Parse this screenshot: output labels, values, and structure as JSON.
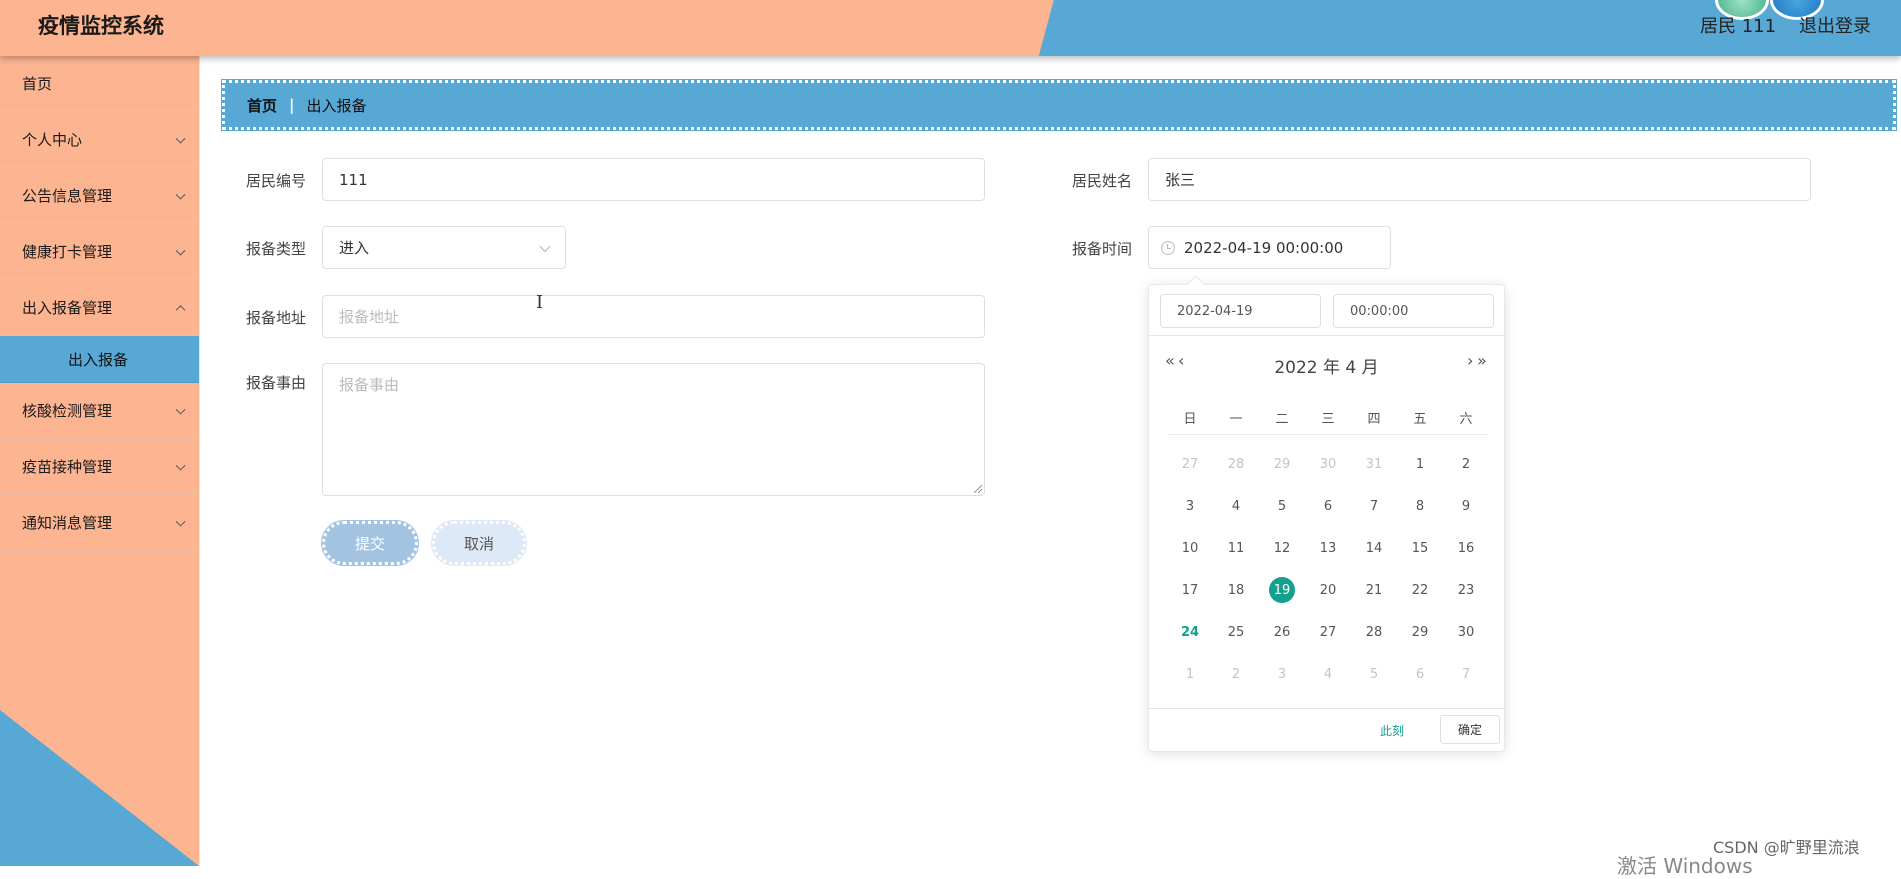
{
  "header": {
    "app_title": "疫情监控系统",
    "user_label": "居民 111",
    "logout": "退出登录"
  },
  "sidebar": {
    "items": [
      {
        "label": "首页"
      },
      {
        "label": "个人中心"
      },
      {
        "label": "公告信息管理"
      },
      {
        "label": "健康打卡管理"
      },
      {
        "label": "出入报备管理"
      },
      {
        "label": "出入报备"
      },
      {
        "label": "核酸检测管理"
      },
      {
        "label": "疫苗接种管理"
      },
      {
        "label": "通知消息管理"
      }
    ]
  },
  "breadcrumb": {
    "home": "首页",
    "separator": "|",
    "current": "出入报备"
  },
  "form": {
    "resident_id": {
      "label": "居民编号",
      "value": "111"
    },
    "resident_name": {
      "label": "居民姓名",
      "value": "张三"
    },
    "report_type": {
      "label": "报备类型",
      "value": "进入"
    },
    "report_time": {
      "label": "报备时间",
      "value": "2022-04-19 00:00:00"
    },
    "report_address": {
      "label": "报备地址",
      "placeholder": "报备地址"
    },
    "report_reason": {
      "label": "报备事由",
      "placeholder": "报备事由"
    },
    "submit": "提交",
    "cancel": "取消"
  },
  "datepicker": {
    "date_input": "2022-04-19",
    "time_input": "00:00:00",
    "prev_year": "«",
    "prev_month": "‹",
    "next_month": "›",
    "next_year": "»",
    "title": "2022 年  4 月",
    "weekdays": [
      "日",
      "一",
      "二",
      "三",
      "四",
      "五",
      "六"
    ],
    "weeks": [
      [
        "27",
        "28",
        "29",
        "30",
        "31",
        "1",
        "2"
      ],
      [
        "3",
        "4",
        "5",
        "6",
        "7",
        "8",
        "9"
      ],
      [
        "10",
        "11",
        "12",
        "13",
        "14",
        "15",
        "16"
      ],
      [
        "17",
        "18",
        "19",
        "20",
        "21",
        "22",
        "23"
      ],
      [
        "24",
        "25",
        "26",
        "27",
        "28",
        "29",
        "30"
      ],
      [
        "1",
        "2",
        "3",
        "4",
        "5",
        "6",
        "7"
      ]
    ],
    "now_button": "此刻",
    "ok_button": "确定"
  },
  "watermark": {
    "csdn": "CSDN @旷野里流浪",
    "windows": "激活 Windows"
  },
  "colors": {
    "header_peach": "#fdb491",
    "accent_blue": "#58a8d6",
    "selected_teal": "#13a08e"
  }
}
